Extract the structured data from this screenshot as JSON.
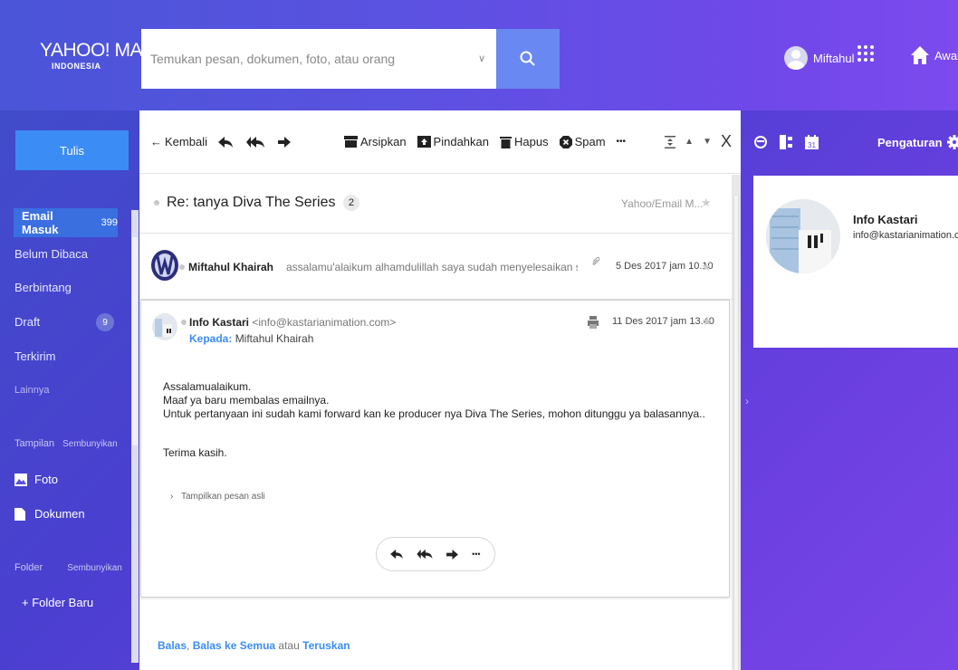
{
  "header": {
    "logo_main": "YAHOO! MAIL",
    "logo_sub": "INDONESIA",
    "search_placeholder": "Temukan pesan, dokumen, foto, atau orang",
    "user_name": "Miftahul",
    "home_label": "Awal"
  },
  "sidebar": {
    "compose_label": "Tulis",
    "inbox_label": "Email Masuk",
    "inbox_count": "399",
    "unread_label": "Belum Dibaca",
    "starred_label": "Berbintang",
    "drafts_label": "Draft",
    "drafts_count": "9",
    "sent_label": "Terkirim",
    "more_label": "Lainnya",
    "views_heading": "Tampilan",
    "views_hide": "Sembunyikan",
    "photos_label": "Foto",
    "docs_label": "Dokumen",
    "folders_heading": "Folder",
    "folders_hide": "Sembunyikan",
    "new_folder_label": "+ Folder Baru"
  },
  "toolbar": {
    "back_label": "Kembali",
    "archive_label": "Arsipkan",
    "move_label": "Pindahkan",
    "delete_label": "Hapus",
    "spam_label": "Spam",
    "more_label": "•••",
    "close_label": "X"
  },
  "thread": {
    "subject": "Re: tanya Diva The Series",
    "count": "2",
    "folder": "Yahoo/Email M..."
  },
  "messages": [
    {
      "sender": "Miftahul Khairah",
      "snippet": "assalamu'alaikum alhamdulillah saya sudah menyelesaikan seminar prc",
      "date": "5 Des 2017 jam 10.10"
    },
    {
      "sender": "Info Kastari",
      "sender_email": "<info@kastarianimation.com>",
      "to_label": "Kepada:",
      "to_name": "Miftahul Khairah",
      "date": "11 Des 2017 jam 13.40",
      "body": [
        "Assalamualaikum.",
        "Maaf ya baru membalas emailnya.",
        "Untuk pertanyaan ini sudah kami forward kan ke producer nya Diva The Series, mohon ditunggu ya balasannya..",
        "Terima kasih."
      ],
      "show_original": "Tampilkan pesan asli"
    }
  ],
  "quick_reply": {
    "reply": "Balas",
    "comma": ", ",
    "reply_all": "Balas ke Semua",
    "or": " atau ",
    "forward": "Teruskan"
  },
  "right_panel": {
    "settings_label": "Pengaturan",
    "contact_name": "Info Kastari",
    "contact_email": "info@kastarianimation.com"
  },
  "colors": {
    "accent": "#3b8cf5",
    "header_start": "#4a55d8",
    "header_end": "#7c4aee"
  }
}
